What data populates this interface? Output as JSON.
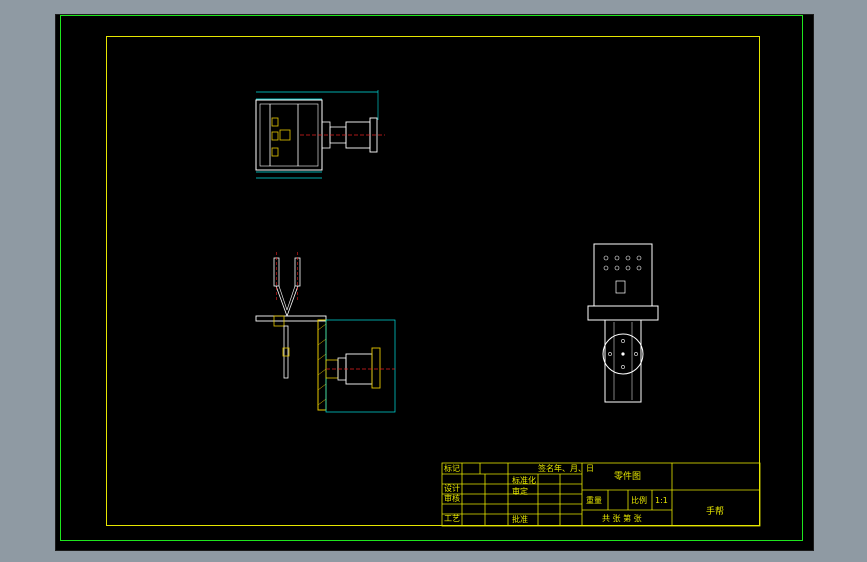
{
  "colors": {
    "background": "#8f9aa3",
    "canvas": "#000000",
    "frame_outer": "#1ee61e",
    "frame_inner": "#e6e600",
    "geometry": "#ffffff",
    "dimension": "#00e6e6",
    "centerline": "#e62020",
    "hatch": "#e6c800"
  },
  "title_block": {
    "col_mark": "标记",
    "col_sign_date": "签名年、月、日",
    "drawing_name": "零件图",
    "row_design": "设计",
    "row_check": "审核",
    "row_process": "工艺",
    "std_check": "标准化",
    "approve": "审定",
    "approve2": "批准",
    "weight_label": "重量",
    "scale_label": "比例",
    "scale_value": "1:1",
    "sheet_info": "共 张 第 张",
    "school": "手帮"
  }
}
